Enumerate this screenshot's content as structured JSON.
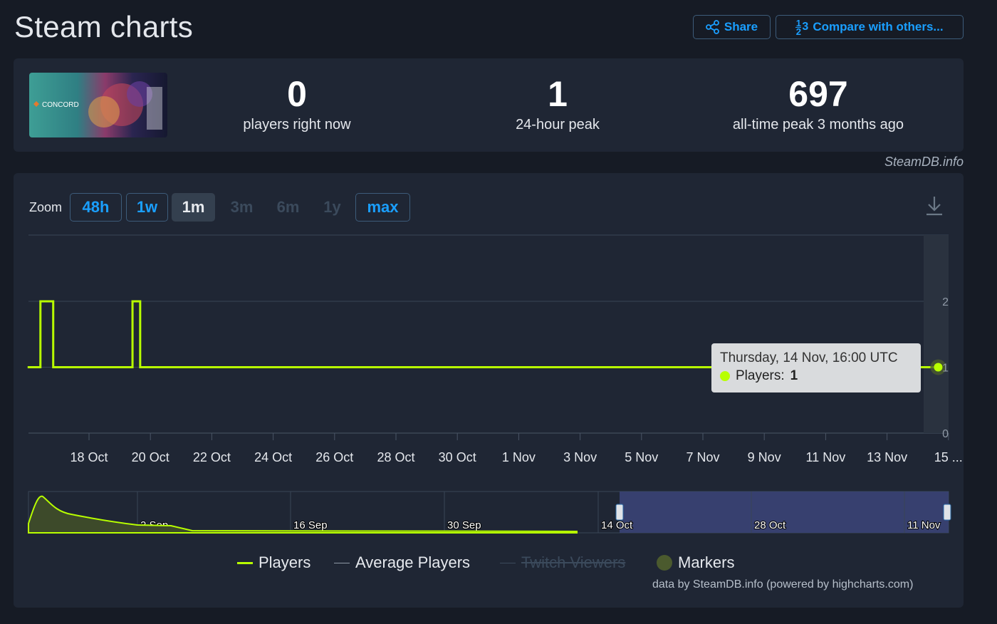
{
  "header": {
    "title": "Steam charts",
    "share_label": "Share",
    "compare_label": "Compare with others...",
    "compare_icon_top": "1",
    "compare_icon_bottom": "2",
    "compare_icon_side": "3"
  },
  "game": {
    "name": "CONCORD",
    "stats": [
      {
        "value": "0",
        "label": "players right now"
      },
      {
        "value": "1",
        "label": "24-hour peak"
      },
      {
        "value": "697",
        "label": "all-time peak 3 months ago"
      }
    ]
  },
  "credit": "SteamDB.info",
  "zoom": {
    "label": "Zoom",
    "options": [
      {
        "label": "48h",
        "state": "enabled"
      },
      {
        "label": "1w",
        "state": "enabled"
      },
      {
        "label": "1m",
        "state": "active"
      },
      {
        "label": "3m",
        "state": "disabled"
      },
      {
        "label": "6m",
        "state": "disabled"
      },
      {
        "label": "1y",
        "state": "disabled"
      },
      {
        "label": "max",
        "state": "enabled"
      }
    ]
  },
  "chart_data": {
    "type": "line",
    "x_ticks": [
      "18 Oct",
      "20 Oct",
      "22 Oct",
      "24 Oct",
      "26 Oct",
      "28 Oct",
      "30 Oct",
      "1 Nov",
      "3 Nov",
      "5 Nov",
      "7 Nov",
      "9 Nov",
      "11 Nov",
      "13 Nov",
      "15 ..."
    ],
    "y_ticks": [
      "0",
      "1",
      "2"
    ],
    "ylim": [
      0,
      2
    ],
    "series": [
      {
        "name": "Players",
        "color": "#b8ff00",
        "points": [
          {
            "x": "2024-10-16T00:00",
            "y": 1
          },
          {
            "x": "2024-10-16T10:00",
            "y": 2
          },
          {
            "x": "2024-10-16T20:00",
            "y": 1
          },
          {
            "x": "2024-10-19T06:00",
            "y": 1
          },
          {
            "x": "2024-10-19T10:00",
            "y": 2
          },
          {
            "x": "2024-10-19T16:00",
            "y": 1
          },
          {
            "x": "2024-11-14T16:00",
            "y": 1
          }
        ]
      }
    ],
    "navigator_ticks": [
      "2 Sep",
      "16 Sep",
      "30 Sep",
      "14 Oct",
      "28 Oct",
      "11 Nov"
    ],
    "grid": true
  },
  "tooltip": {
    "date": "Thursday, 14 Nov, 16:00 UTC",
    "series_label": "Players:",
    "value": "1"
  },
  "legend": [
    {
      "label": "Players",
      "color": "#b8ff00",
      "enabled": true
    },
    {
      "label": "Average Players",
      "color": "#8f99a6",
      "enabled": true
    },
    {
      "label": "Twitch Viewers",
      "color": "#3b4a5c",
      "enabled": false
    },
    {
      "label": "Markers",
      "color": "#4b5a2e",
      "enabled": true
    }
  ],
  "footer_credit": "data by SteamDB.info (powered by highcharts.com)"
}
